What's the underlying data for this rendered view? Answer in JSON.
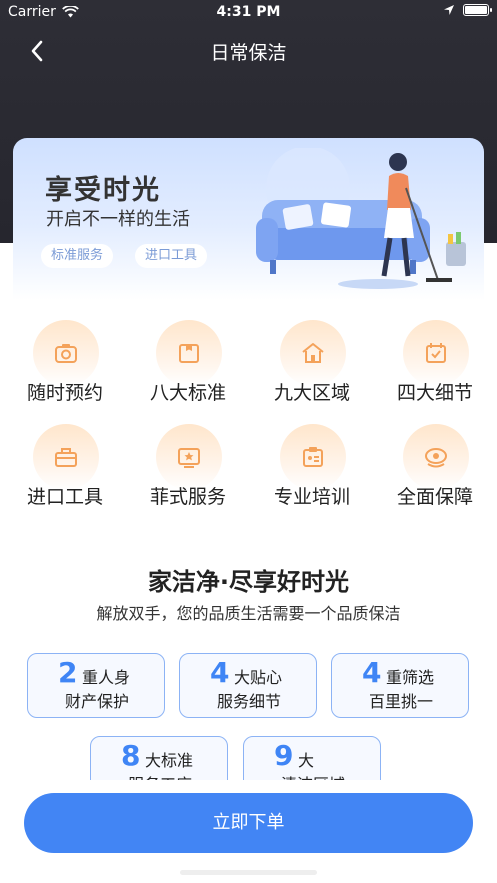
{
  "status": {
    "carrier": "Carrier",
    "time": "4:31 PM",
    "battery_level": 1.0
  },
  "nav": {
    "title": "日常保洁",
    "back_icon": "chevron-left-icon"
  },
  "banner": {
    "title": "享受时光",
    "subtitle": "开启不一样的生活",
    "tags": [
      "标准服务",
      "进口工具"
    ]
  },
  "features": [
    {
      "label": "随时预约",
      "icon": "camera-icon"
    },
    {
      "label": "八大标准",
      "icon": "box-icon"
    },
    {
      "label": "九大区域",
      "icon": "home-icon"
    },
    {
      "label": "四大细节",
      "icon": "calendar-check-icon"
    },
    {
      "label": "进口工具",
      "icon": "toolbox-icon"
    },
    {
      "label": "菲式服务",
      "icon": "star-badge-icon"
    },
    {
      "label": "专业培训",
      "icon": "clipboard-icon"
    },
    {
      "label": "全面保障",
      "icon": "shield-eye-icon"
    }
  ],
  "slogan": {
    "title": "家洁净·尽享好时光",
    "subtitle": "解放双手，您的品质生活需要一个品质保洁"
  },
  "cards": [
    {
      "num": "2",
      "t1": "重人身",
      "t2": "财产保护"
    },
    {
      "num": "4",
      "t1": "大贴心",
      "t2": "服务细节"
    },
    {
      "num": "4",
      "t1": "重筛选",
      "t2": "百里挑一"
    },
    {
      "num": "8",
      "t1": "大标准",
      "t2": "服务工序"
    },
    {
      "num": "9",
      "t1": "大",
      "t2": "清洁区域"
    }
  ],
  "action": {
    "order_label": "立即下单"
  },
  "colors": {
    "accent": "#4285f4",
    "dark_header": "#2e2e36",
    "icon_orange": "#f4a25a"
  }
}
